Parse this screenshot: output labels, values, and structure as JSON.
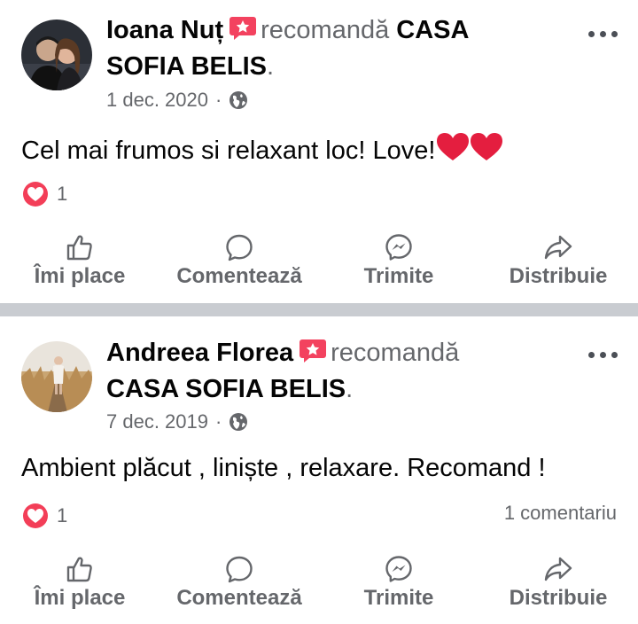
{
  "posts": [
    {
      "author": "Ioana Nuț",
      "verb": "recomandă",
      "page": "CASA SOFIA BELIS",
      "period": ".",
      "date": "1 dec. 2020",
      "separator": "·",
      "text": "Cel mai frumos si relaxant loc! Love!",
      "reaction_count": "1",
      "comments": ""
    },
    {
      "author": "Andreea Florea",
      "verb": "recomandă",
      "page": "CASA SOFIA BELIS",
      "period": ".",
      "date": "7 dec. 2019",
      "separator": "·",
      "text": "Ambient plăcut , liniște , relaxare. Recomand !",
      "reaction_count": "1",
      "comments": "1 comentariu"
    }
  ],
  "actions": {
    "like": "Îmi place",
    "comment": "Comentează",
    "send": "Trimite",
    "share": "Distribuie"
  },
  "icons": {
    "recommend_badge": "recommend-star-icon",
    "privacy": "globe-icon",
    "more": "more-horizontal-icon",
    "reaction": "heart-reaction-icon",
    "like": "thumbs-up-icon",
    "comment": "comment-bubble-icon",
    "send": "messenger-icon",
    "share": "share-arrow-icon"
  },
  "colors": {
    "text_primary": "#050505",
    "text_secondary": "#65676b",
    "badge": "#f3425f",
    "heart": "#e41e3f",
    "separator": "#c9ccd1"
  }
}
